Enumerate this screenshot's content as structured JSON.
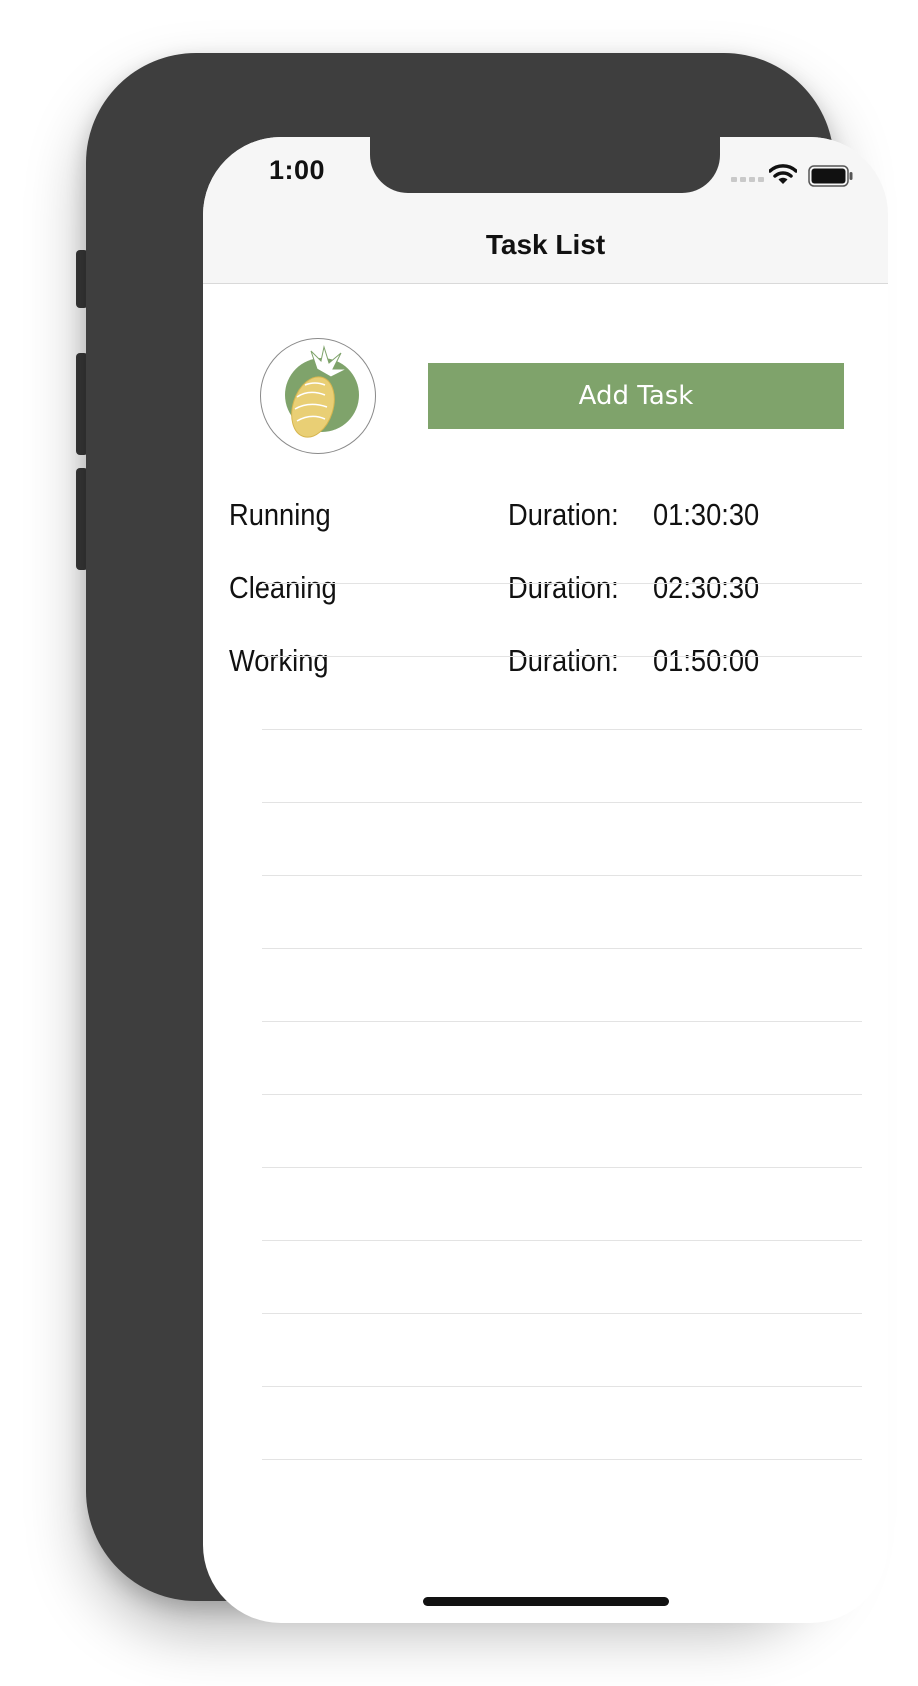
{
  "status_bar": {
    "time": "1:00"
  },
  "nav": {
    "title": "Task List"
  },
  "actions": {
    "add_task_label": "Add Task"
  },
  "tasks": [
    {
      "name": "Running",
      "duration_label": "Duration:",
      "duration": "01:30:30"
    },
    {
      "name": "Cleaning",
      "duration_label": "Duration:",
      "duration": "02:30:30"
    },
    {
      "name": "Working",
      "duration_label": "Duration:",
      "duration": "01:50:00"
    }
  ],
  "colors": {
    "accent": "#7fa36b",
    "phone_frame": "#3e3e3e",
    "nav_background": "#f6f6f6",
    "pineapple": "#e9cf75"
  },
  "icons": {
    "logo": "pineapple-logo-icon",
    "signal": "cellular-signal-icon",
    "wifi": "wifi-icon",
    "battery": "battery-icon"
  }
}
